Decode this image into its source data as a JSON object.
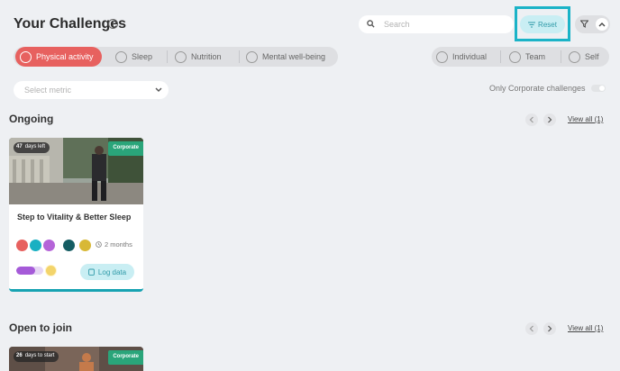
{
  "header": {
    "title": "Your Challenges",
    "info_icon": "info-icon",
    "search_placeholder": "Search",
    "reset_label": "Reset"
  },
  "categories": [
    {
      "label": "Physical activity",
      "icon": "running-icon",
      "active": true
    },
    {
      "label": "Sleep",
      "icon": "moon-icon",
      "active": false
    },
    {
      "label": "Nutrition",
      "icon": "apple-icon",
      "active": false
    },
    {
      "label": "Mental well-being",
      "icon": "eye-icon",
      "active": false
    }
  ],
  "types": [
    {
      "label": "Individual",
      "icon": "individual-icon"
    },
    {
      "label": "Team",
      "icon": "team-icon"
    },
    {
      "label": "Self",
      "icon": "self-icon"
    }
  ],
  "filters": {
    "metric_placeholder": "Select metric",
    "corporate_label": "Only Corporate challenges",
    "corporate_on": false
  },
  "ongoing": {
    "title": "Ongoing",
    "view_all": "View all (1)",
    "cards": [
      {
        "days_value": "47",
        "days_label": "days left",
        "badge": "Corporate",
        "title": "Step to Vitality & Better Sleep",
        "duration": "2 months",
        "log_label": "Log data",
        "progress": 0.7
      }
    ]
  },
  "open": {
    "title": "Open to join",
    "view_all": "View all (1)",
    "cards": [
      {
        "days_value": "26",
        "days_label": "days to start",
        "badge": "Corporate"
      }
    ]
  },
  "colors": {
    "accent": "#1bb3c7",
    "active_category": "#e7615f",
    "corporate": "#2aa57a"
  }
}
